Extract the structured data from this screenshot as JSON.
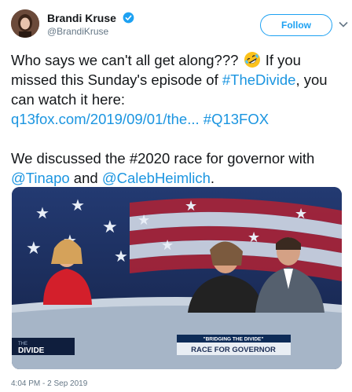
{
  "user": {
    "display_name": "Brandi Kruse",
    "handle": "@BrandiKruse",
    "verified_icon": "verified-badge-icon",
    "verified_color": "#1da1f2"
  },
  "actions": {
    "follow_label": "Follow",
    "more_icon": "chevron-down-icon"
  },
  "tweet": {
    "line1_prefix": "Who says we can't all get along???",
    "emoji_icon": "rolling-on-floor-laughing-emoji",
    "line1_suffix": " If you missed this Sunday's episode of ",
    "hashtag_divide": "#TheDivide",
    "line1_end": ", you can watch it here:",
    "link_url": "q13fox.com/2019/09/01/the...",
    "hashtag_q13": "#Q13FOX",
    "line2_prefix": "We discussed the #2020 race for governor with ",
    "mention_tinapo": "@Tinapo",
    "and_text": " and ",
    "mention_caleb": "@CalebHeimlich",
    "line2_end": "."
  },
  "media": {
    "show_logo_small": "THE",
    "show_logo_large": "DIVIDE",
    "banner_tag": "\"BRIDGING THE DIVIDE\"",
    "banner_title": "RACE FOR GOVERNOR"
  },
  "meta": {
    "timestamp": "4:04 PM - 2 Sep 2019"
  },
  "colors": {
    "link": "#1b95e0",
    "text": "#14171a",
    "secondary": "#657786"
  }
}
